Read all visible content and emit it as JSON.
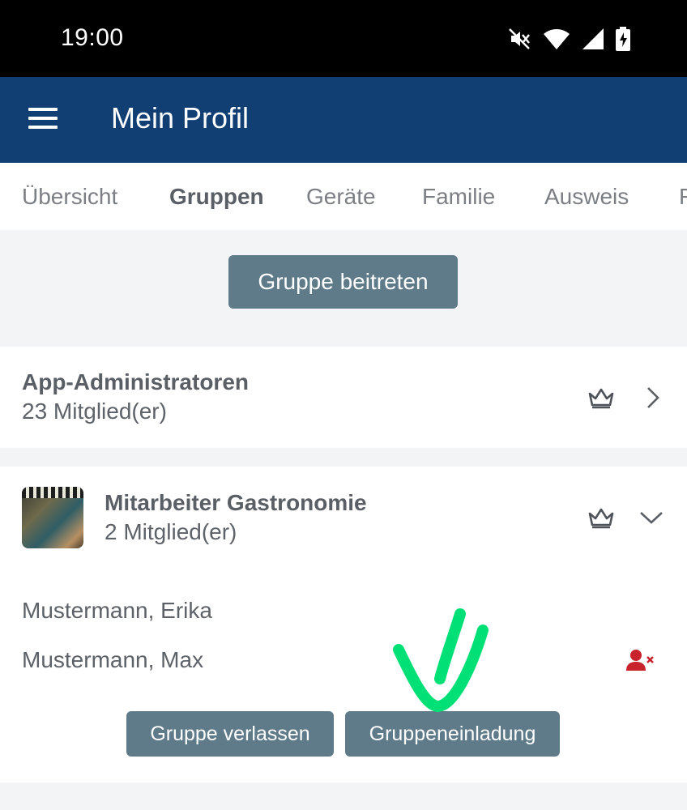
{
  "status_bar": {
    "time": "19:00",
    "icons": [
      "mute-icon",
      "wifi-icon",
      "signal-icon",
      "battery-charging-icon"
    ]
  },
  "app_bar": {
    "title": "Mein Profil"
  },
  "tabs": [
    {
      "label": "Übersicht",
      "active": false
    },
    {
      "label": "Gruppen",
      "active": true
    },
    {
      "label": "Geräte",
      "active": false
    },
    {
      "label": "Familie",
      "active": false
    },
    {
      "label": "Ausweis",
      "active": false
    }
  ],
  "join_button": {
    "label": "Gruppe beitreten"
  },
  "groups": [
    {
      "name": "App-Administratoren",
      "members_count": "23 Mitglied(er)",
      "icons": [
        "crown-icon",
        "chevron-right-icon"
      ]
    },
    {
      "name": "Mitarbeiter Gastronomie",
      "members_count": "2 Mitglied(er)",
      "icons": [
        "crown-icon",
        "chevron-down-icon"
      ],
      "members": [
        "Mustermann, Erika",
        "Mustermann, Max"
      ],
      "leave_label": "Gruppe verlassen",
      "invite_label": "Gruppeneinladung"
    }
  ],
  "colors": {
    "app_bar": "#123f73",
    "button": "#5f7b89",
    "remove_user": "#c8232c",
    "annotation": "#00e076"
  }
}
